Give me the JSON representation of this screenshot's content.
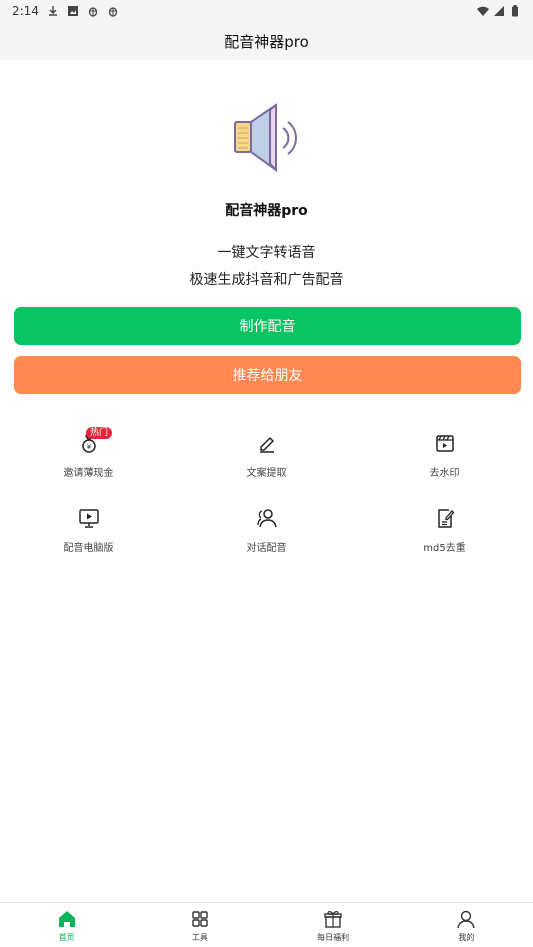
{
  "status_bar": {
    "time": "2:14"
  },
  "app_bar": {
    "title": "配音神器pro"
  },
  "hero": {
    "app_name": "配音神器pro",
    "tagline_line1": "一键文字转语音",
    "tagline_line2": "极速生成抖音和广告配音"
  },
  "buttons": {
    "make_dubbing": "制作配音",
    "recommend": "推荐给朋友"
  },
  "features": [
    {
      "label": "邀请薄现金",
      "icon": "money-bag-icon",
      "badge": "热门"
    },
    {
      "label": "文案提取",
      "icon": "pen-icon"
    },
    {
      "label": "去水印",
      "icon": "clapperboard-icon"
    },
    {
      "label": "配音电脑版",
      "icon": "monitor-play-icon"
    },
    {
      "label": "对话配音",
      "icon": "users-icon"
    },
    {
      "label": "md5去重",
      "icon": "edit-document-icon"
    }
  ],
  "bottom_nav": [
    {
      "label": "首页",
      "icon": "home-icon",
      "active": true
    },
    {
      "label": "工具",
      "icon": "grid-icon"
    },
    {
      "label": "每日福利",
      "icon": "gift-icon"
    },
    {
      "label": "我的",
      "icon": "person-icon"
    }
  ],
  "colors": {
    "primary_green": "#09c463",
    "accent_orange": "#ff8752",
    "badge_red": "#e8233a"
  }
}
